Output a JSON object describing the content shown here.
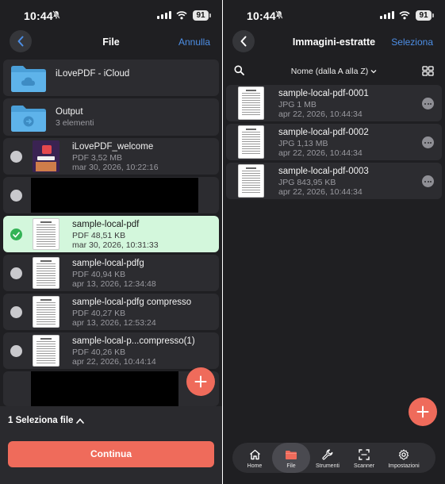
{
  "status_left": {
    "time": "10:44",
    "battery": "91"
  },
  "status_right": {
    "time": "10:44",
    "battery": "91"
  },
  "left": {
    "nav": {
      "title": "File",
      "action": "Annulla"
    },
    "folders": [
      {
        "name": "iLovePDF - iCloud",
        "sub": ""
      },
      {
        "name": "Output",
        "sub": "3 elementi"
      }
    ],
    "files": [
      {
        "name": "iLovePDF_welcome",
        "meta": "PDF 3,52 MB",
        "date": "mar 30, 2026, 10:22:16"
      },
      {
        "name": "sample-local-pdf",
        "meta": "PDF 48,51 KB",
        "date": "mar 30, 2026, 10:31:33"
      },
      {
        "name": "sample-local-pdfg",
        "meta": "PDF 40,94 KB",
        "date": "apr 13, 2026, 12:34:48"
      },
      {
        "name": "sample-local-pdfg compresso",
        "meta": "PDF 40,27 KB",
        "date": "apr 13, 2026, 12:53:24"
      },
      {
        "name": "sample-local-p...compresso(1)",
        "meta": "PDF 40,26 KB",
        "date": "apr 22, 2026, 10:44:14"
      }
    ],
    "selection_summary": "1 Seleziona file",
    "continue_label": "Continua"
  },
  "right": {
    "nav": {
      "title": "Immagini-estratte",
      "action": "Seleziona"
    },
    "sort_label": "Nome (dalla A alla Z)",
    "images": [
      {
        "name": "sample-local-pdf-0001",
        "meta": "JPG 1 MB",
        "date": "apr 22, 2026, 10:44:34"
      },
      {
        "name": "sample-local-pdf-0002",
        "meta": "JPG 1,13 MB",
        "date": "apr 22, 2026, 10:44:34"
      },
      {
        "name": "sample-local-pdf-0003",
        "meta": "JPG 843,95 KB",
        "date": "apr 22, 2026, 10:44:34"
      }
    ],
    "tabs": [
      {
        "label": "Home",
        "icon": "home-icon"
      },
      {
        "label": "File",
        "icon": "folder-icon"
      },
      {
        "label": "Strumenti",
        "icon": "wrench-icon"
      },
      {
        "label": "Scanner",
        "icon": "scan-icon"
      },
      {
        "label": "Impostazioni",
        "icon": "gear-icon"
      }
    ],
    "active_tab": "File"
  },
  "colors": {
    "background": "#1f1f22",
    "row": "#2c2c30",
    "accent_blue": "#4d8fe6",
    "accent_coral": "#ef6b5b",
    "selected_row": "#d3f7dc",
    "check_green": "#34b356",
    "folder_blue": "#5aaee6"
  }
}
